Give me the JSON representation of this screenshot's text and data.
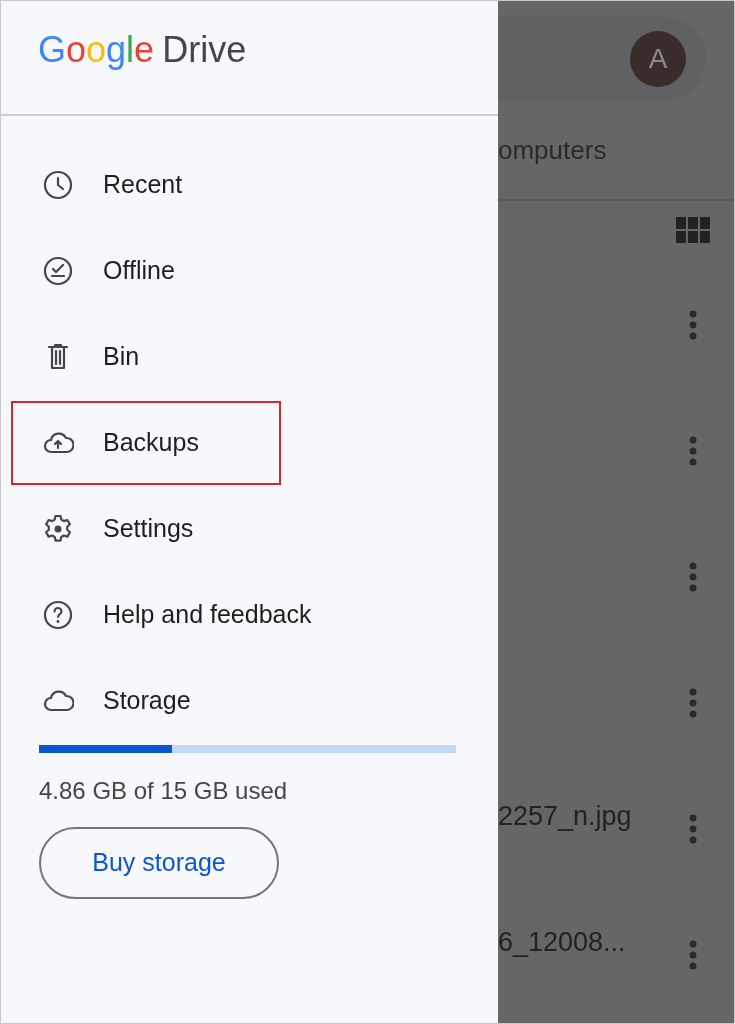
{
  "drawer": {
    "logo": {
      "letters": [
        {
          "text": "G",
          "color": "#4285f4"
        },
        {
          "text": "o",
          "color": "#ea4335"
        },
        {
          "text": "o",
          "color": "#fbbc05"
        },
        {
          "text": "g",
          "color": "#4285f4"
        },
        {
          "text": "l",
          "color": "#34a853"
        },
        {
          "text": "e",
          "color": "#ea4335"
        }
      ],
      "product": "Drive"
    },
    "items": [
      {
        "kind": "clock",
        "label": "Recent",
        "highlighted": false
      },
      {
        "kind": "offline",
        "label": "Offline",
        "highlighted": false
      },
      {
        "kind": "trash",
        "label": "Bin",
        "highlighted": false
      },
      {
        "kind": "cloud-upload",
        "label": "Backups",
        "highlighted": true
      },
      {
        "kind": "gear",
        "label": "Settings",
        "highlighted": false
      },
      {
        "kind": "help",
        "label": "Help and feedback",
        "highlighted": false
      },
      {
        "kind": "cloud",
        "label": "Storage",
        "highlighted": false
      }
    ],
    "storage": {
      "level": 0.32,
      "usage": "4.86 GB of 15 GB used",
      "button": "Buy storage"
    }
  },
  "background": {
    "avatar": "A",
    "tab": "omputers",
    "rows": [
      {
        "name": ""
      },
      {
        "name": ""
      },
      {
        "name": ""
      },
      {
        "name": ""
      },
      {
        "name": "2257_n.jpg"
      },
      {
        "name": "6_12008..."
      }
    ]
  }
}
